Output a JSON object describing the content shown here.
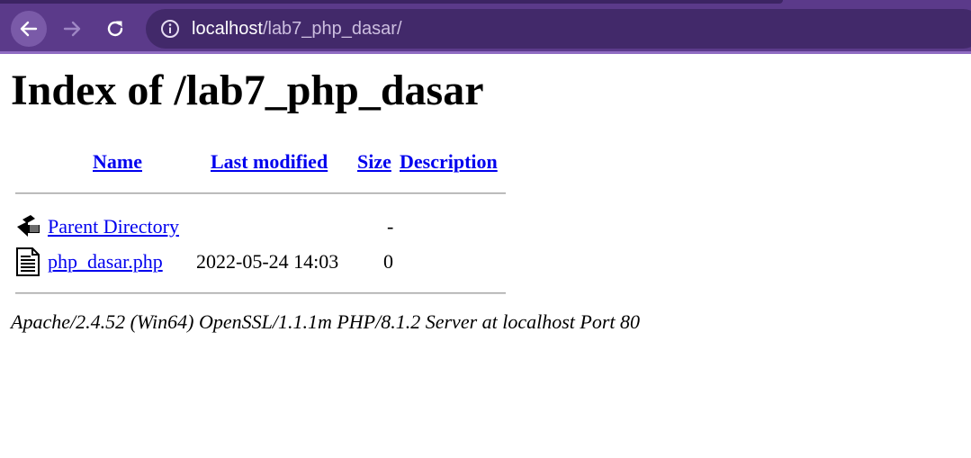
{
  "browser": {
    "url_host": "localhost",
    "url_path": "/lab7_php_dasar/"
  },
  "page": {
    "title": "Index of /lab7_php_dasar",
    "columns": {
      "name": "Name",
      "last_modified": "Last modified",
      "size": "Size",
      "description": "Description"
    },
    "rows": [
      {
        "icon": "back-folder-icon",
        "name": "Parent Directory",
        "last_modified": "",
        "size": "-"
      },
      {
        "icon": "text-file-icon",
        "name": "php_dasar.php",
        "last_modified": "2022-05-24 14:03",
        "size": "0"
      }
    ],
    "footer": "Apache/2.4.52 (Win64) OpenSSL/1.1.1m PHP/8.1.2 Server at localhost Port 80"
  },
  "colors": {
    "toolbar": "#5b3a8a",
    "omnibox": "#42296a",
    "link": "#0000ee"
  }
}
